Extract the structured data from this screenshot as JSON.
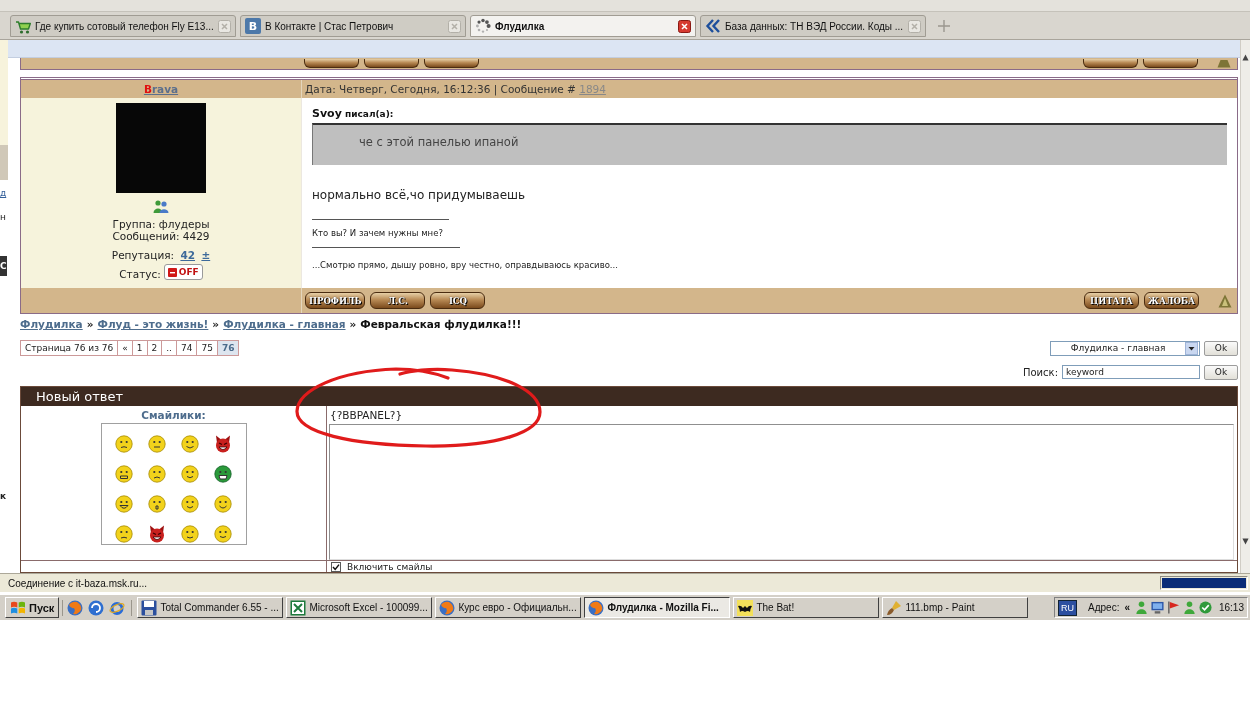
{
  "browser": {
    "tabs": [
      {
        "title": "Где купить сотовый телефон Fly E13...",
        "kind": "cart",
        "selected": false
      },
      {
        "title": "В Контакте | Стас Петрович",
        "kind": "letter",
        "icon_text": "В",
        "selected": false
      },
      {
        "title": "Флудилка",
        "kind": "spinner",
        "selected": true
      },
      {
        "title": "База данных: ТН ВЭД России. Коды ...",
        "kind": "chevrons",
        "selected": false
      }
    ]
  },
  "left_frame": [
    {
      "text": "д",
      "kind": "link"
    },
    {
      "text": "н",
      "kind": "plain"
    },
    {
      "text": "С",
      "kind": "block"
    },
    {
      "text": "к",
      "kind": "bold"
    }
  ],
  "post": {
    "author": "Brava",
    "date": "Дата: Четверг, Сегодня, 16:12:36 | Сообщение #",
    "number": "1894",
    "group": "Группа: флудеры",
    "posts": "Сообщений: 4429",
    "reputation_label": "Репутация:",
    "reputation": "42",
    "reputation_toggle": "±",
    "status_label": "Статус:",
    "status": "OFF",
    "quote_author": "Svoy",
    "quote_caption": "писал(а):",
    "quote": "че с этой панелью ипаной",
    "message": "нормально всё,чо придумываешь",
    "signature": [
      "Кто вы? И зачем нужны мне?",
      "...Смотрю прямо, дышу ровно, вру честно, оправдываюсь красиво..."
    ],
    "buttons_left": [
      "ПРОФИЛЬ",
      "Л.С.",
      "ICQ"
    ],
    "buttons_right": [
      "ЦИТАТА",
      "ЖАЛОБА"
    ]
  },
  "breadcrumbs": [
    {
      "label": "Флудилка",
      "kind": "link"
    },
    {
      "label": "»",
      "kind": "separator"
    },
    {
      "label": "Флуд - это жизнь!",
      "kind": "link"
    },
    {
      "label": "»",
      "kind": "separator"
    },
    {
      "label": "Флудилка - главная",
      "kind": "link"
    },
    {
      "label": "»",
      "kind": "separator"
    },
    {
      "label": "Февральская флудилка!!!",
      "kind": "current"
    }
  ],
  "pagination": {
    "caption": "Страница 76 из 76",
    "pages": [
      {
        "label": "«",
        "selected": false
      },
      {
        "label": "1",
        "selected": false
      },
      {
        "label": "2",
        "selected": false
      },
      {
        "label": "..",
        "selected": false
      },
      {
        "label": "74",
        "selected": false
      },
      {
        "label": "75",
        "selected": false
      },
      {
        "label": "76",
        "selected": true
      }
    ]
  },
  "jump": {
    "value": "Флудилка - главная",
    "button": "Ok"
  },
  "search": {
    "label": "Поиск:",
    "value": "keyword",
    "button": "Ok"
  },
  "reply": {
    "title": "Новый ответ",
    "smilies_label": "Смайлики:",
    "bbpanel": "{?BBPANEL?}",
    "smilies_option": {
      "label": "Включить смайлы",
      "checked": true
    }
  },
  "status_bar": {
    "text": "Соединение с it-baza.msk.ru...",
    "level": 1
  },
  "taskbar": {
    "start": "Пуск",
    "tasks": [
      {
        "title": "Total Commander 6.55 - ...",
        "kind": "floppy",
        "selected": false
      },
      {
        "title": "Microsoft Excel - 100099...",
        "kind": "sheet",
        "selected": false
      },
      {
        "title": "Курс евро - Официальн...",
        "kind": "globe",
        "selected": false
      },
      {
        "title": "Флудилка - Mozilla Fi...",
        "kind": "globe",
        "selected": true
      },
      {
        "title": "The Bat!",
        "kind": "bat",
        "selected": false
      },
      {
        "title": "111.bmp - Paint",
        "kind": "brush",
        "selected": false
      }
    ],
    "language": "RU",
    "address_label": "Адрес:",
    "chevron": "«",
    "clock": "16:13"
  }
}
